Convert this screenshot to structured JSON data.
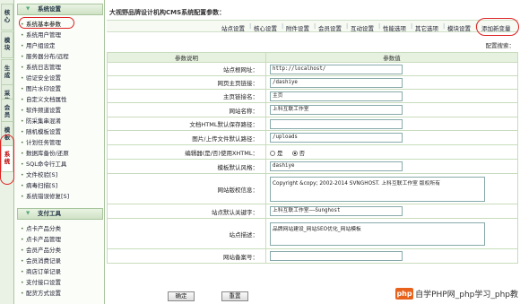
{
  "vtabs": [
    "核心",
    "模块",
    "生成",
    "采集",
    "会员",
    "模板",
    "系统"
  ],
  "sidebar": {
    "section1": {
      "title": "系统设置",
      "items": [
        "系统基本参数",
        "系统用户管理",
        "用户组设定",
        "服务器分布/远程",
        "系统日志管理",
        "验证安全设置",
        "图片水印设置",
        "自定义文档属性",
        "软件频道设置",
        "防采集串混淆",
        "随机模板设置",
        "计划任务管理",
        "数据库备份/还原",
        "SQL命令行工具",
        "文件校验[S]",
        "病毒扫描[S]",
        "系统错误修复[S]"
      ]
    },
    "section2": {
      "title": "支付工具",
      "items": [
        "点卡产品分类",
        "点卡产品管理",
        "会员产品分类",
        "会员消费记录",
        "商店订单记录",
        "支付接口设置",
        "配货方式设置"
      ]
    }
  },
  "main": {
    "title": "大视野品牌设计机构CMS系统配置参数：",
    "top_links": [
      "站点设置",
      "核心设置",
      "附件设置",
      "会员设置",
      "互动设置",
      "性能选项",
      "其它选项",
      "模块设置",
      "添加新变量"
    ],
    "search_label": "配置搜索：",
    "table_headers": [
      "参数说明",
      "参数值"
    ],
    "rows": [
      {
        "label": "站点根网址：",
        "value": "http://localhost/"
      },
      {
        "label": "网页主页链接：",
        "value": "/dashiye"
      },
      {
        "label": "主页链接名：",
        "value": "主页"
      },
      {
        "label": "网站名称：",
        "value": "上科互联工作室"
      },
      {
        "label": "文档HTML默认保存路径：",
        "value": ""
      },
      {
        "label": "图片/上传文件默认路径：",
        "value": "/uploads"
      },
      {
        "label": "编辑器(是/否)使用XHTML：",
        "radio_yes": "是",
        "radio_no": "否"
      },
      {
        "label": "模板默认风格：",
        "value": "dashiye"
      },
      {
        "label": "网站版权信息：",
        "value": "Copyright &copy; 2002-2014 SVNGHOST. 上科互联工作室 版权所有"
      },
      {
        "label": "站点默认关键字：",
        "value": "上科互联工作室——Sunghost"
      },
      {
        "label": "站点描述：",
        "value": "品牌网站建设_网站SEO优化_网站模板"
      },
      {
        "label": "网站备案号：",
        "value": ""
      }
    ],
    "buttons": {
      "confirm": "确定",
      "reset": "重置"
    }
  },
  "watermark": {
    "logo": "php",
    "text": "自学PHP网_php学习_php教"
  }
}
